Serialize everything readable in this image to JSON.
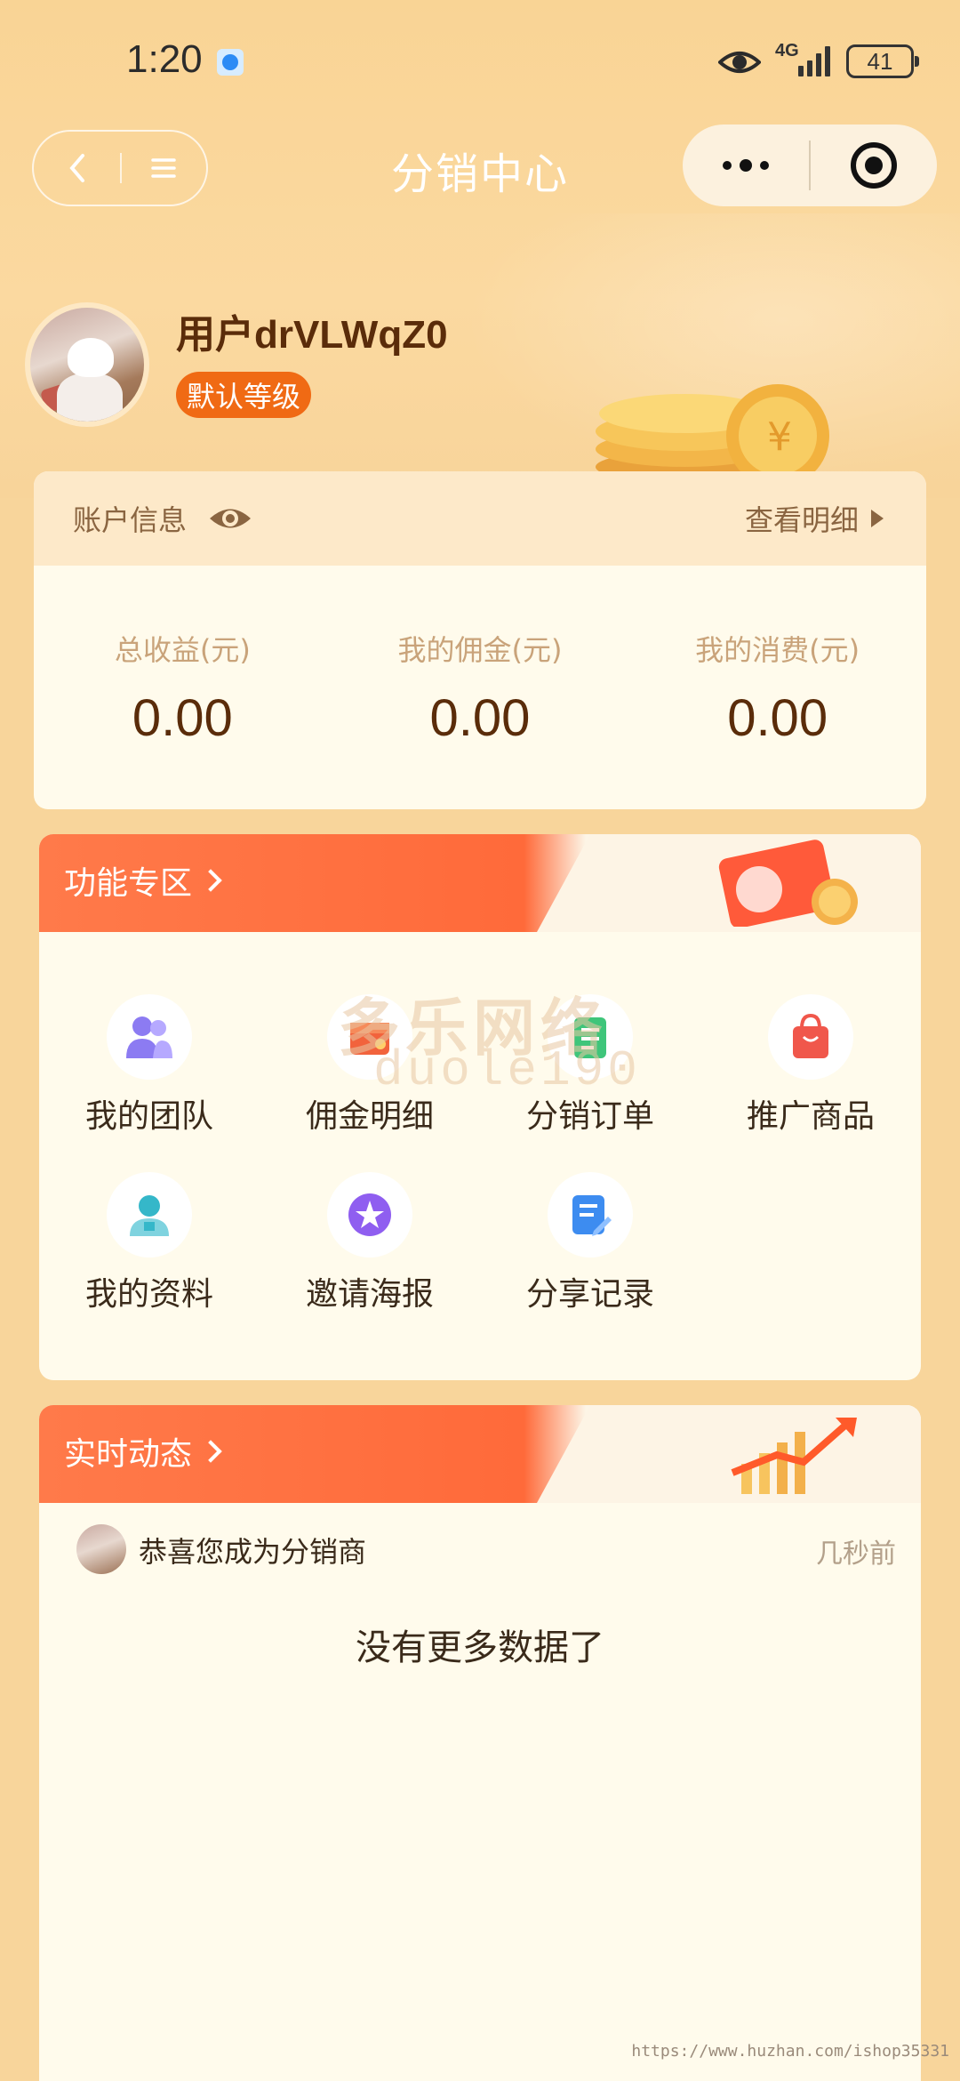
{
  "status_bar": {
    "time": "1:20",
    "network": "4G",
    "battery": "41"
  },
  "nav": {
    "title": "分销中心"
  },
  "profile": {
    "username": "用户drVLWqZ0",
    "level": "默认等级"
  },
  "account": {
    "title": "账户信息",
    "detail_link": "查看明细",
    "stats": [
      {
        "label": "总收益(元)",
        "value": "0.00"
      },
      {
        "label": "我的佣金(元)",
        "value": "0.00"
      },
      {
        "label": "我的消费(元)",
        "value": "0.00"
      }
    ]
  },
  "functions": {
    "title": "功能专区",
    "items": [
      {
        "label": "我的团队",
        "icon": "team-icon"
      },
      {
        "label": "佣金明细",
        "icon": "commission-icon"
      },
      {
        "label": "分销订单",
        "icon": "orders-icon"
      },
      {
        "label": "推广商品",
        "icon": "shopping-bag-icon"
      },
      {
        "label": "我的资料",
        "icon": "profile-icon"
      },
      {
        "label": "邀请海报",
        "icon": "poster-icon"
      },
      {
        "label": "分享记录",
        "icon": "share-record-icon"
      }
    ]
  },
  "realtime": {
    "title": "实时动态",
    "items": [
      {
        "text": "恭喜您成为分销商",
        "time": "几秒前"
      }
    ],
    "empty_text": "没有更多数据了"
  },
  "watermark": {
    "line1": "多乐网络",
    "line2": "duole190"
  },
  "footer": {
    "url": "https://www.huzhan.com/ishop35331"
  },
  "colors": {
    "background": "#f8d59b",
    "accent": "#f06a14",
    "card": "#fffbec",
    "section_header": "#ff6a3a"
  }
}
